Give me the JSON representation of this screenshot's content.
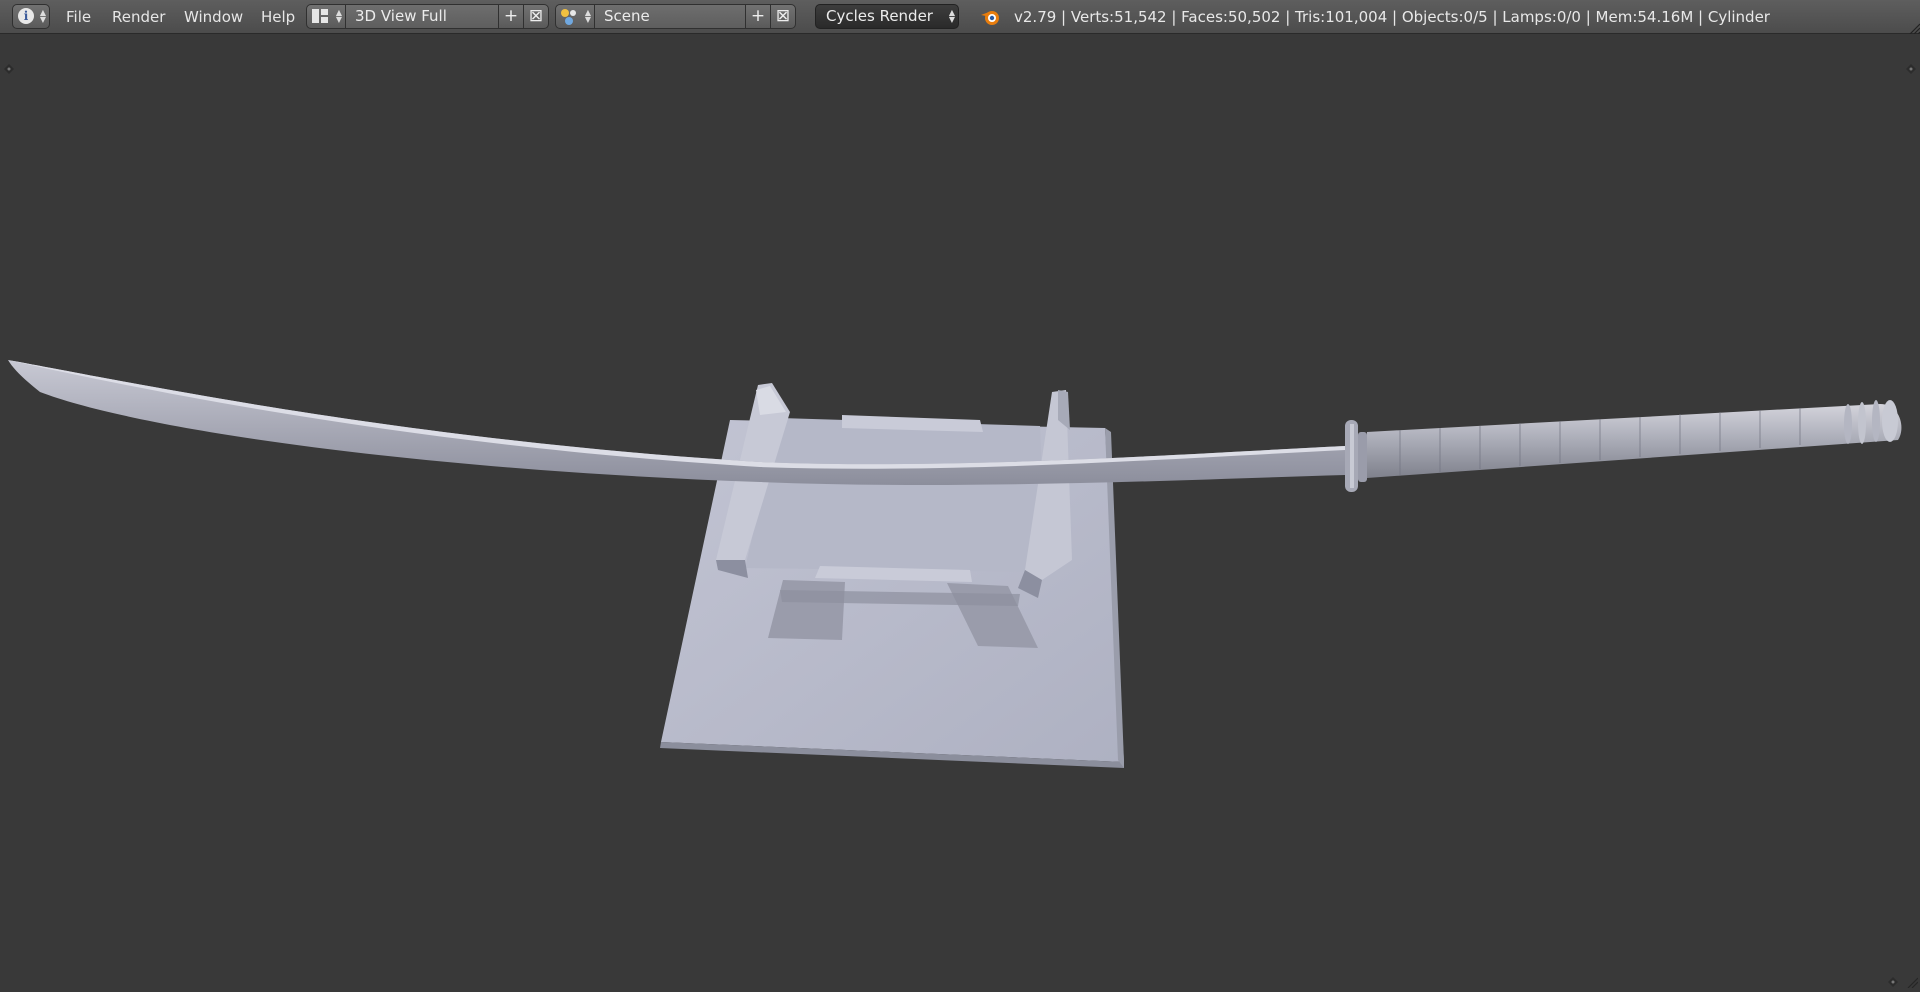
{
  "header": {
    "editor_type_icon": "info-icon",
    "menus": [
      "File",
      "Render",
      "Window",
      "Help"
    ],
    "screen_layout": {
      "icon": "screen-layout-icon",
      "value": "3D View Full"
    },
    "scene": {
      "icon": "scene-icon",
      "value": "Scene"
    },
    "render_engine": "Cycles Render",
    "blender_logo_icon": "blender-logo-icon",
    "stats": "v2.79 | Verts:51,542 | Faces:50,502 | Tris:101,004 | Objects:0/5 | Lamps:0/0 | Mem:54.16M | Cylinder"
  },
  "viewport": {
    "objects": [
      "katana",
      "sword-stand"
    ],
    "colors": {
      "background": "#393939",
      "model": "#b9bccb"
    }
  }
}
